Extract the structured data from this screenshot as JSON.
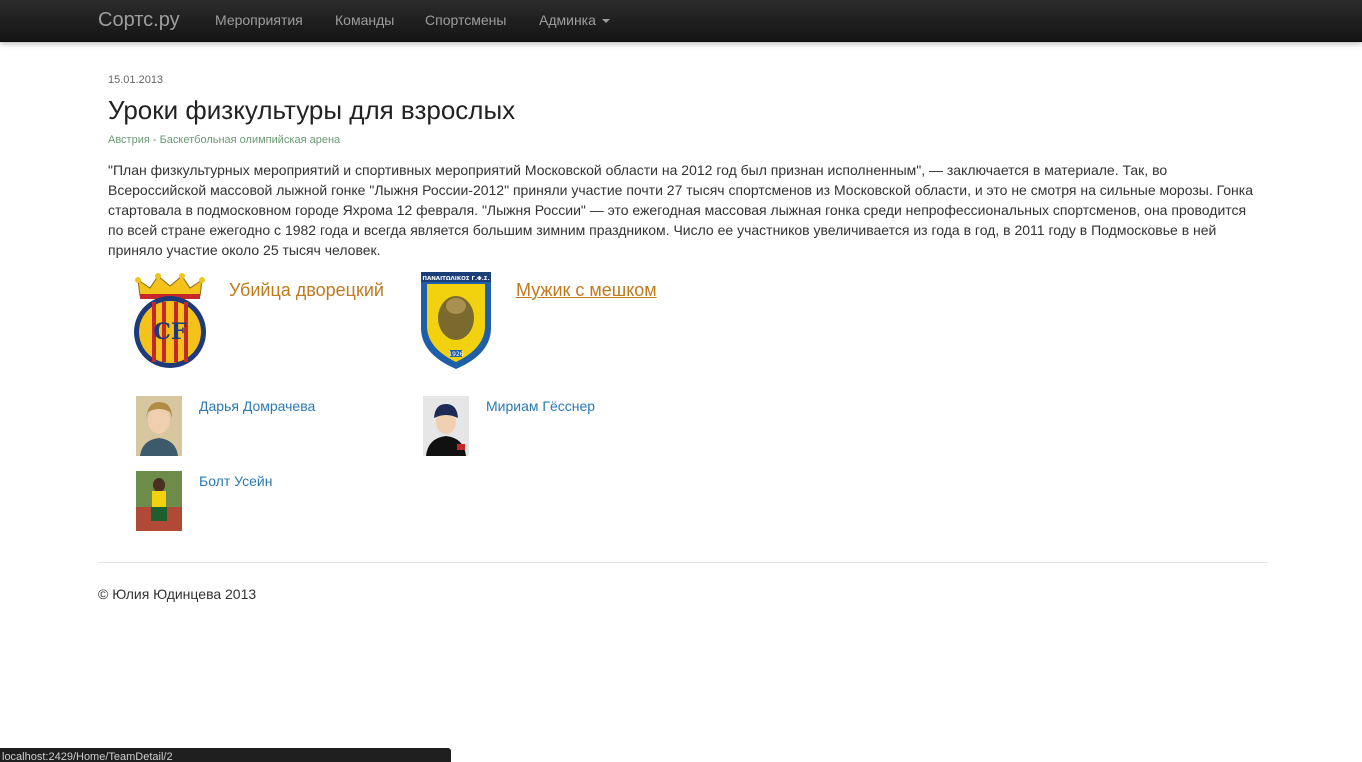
{
  "navbar": {
    "brand": "Сортс.ру",
    "links": [
      "Мероприятия",
      "Команды",
      "Спортсмены"
    ],
    "dropdown_label": "Админка"
  },
  "event": {
    "date": "15.01.2013",
    "title": "Уроки физкультуры для взрослых",
    "location": "Австрия - Баскетбольная олимпийская арена",
    "description": "\"План физкультурных мероприятий и спортивных мероприятий Московской области на 2012 год был признан исполненным\", — заключается в материале. Так, во Всероссийской массовой лыжной гонке \"Лыжня России-2012\" приняли участие почти 27 тысяч спортсменов из Московской области, и это не смотря на сильные морозы. Гонка стартовала в подмосковном городе Яхрома 12 февраля. \"Лыжня России\" — это ежегодная массовая лыжная гонка среди непрофессиональных спортсменов, она проводится по всей стране ежегодно с 1982 года и всегда является большим зимним праздником. Число ее участников увеличивается из года в год, в 2011 году в Подмосковье в ней приняло участие около 25 тысяч человек."
  },
  "teams": [
    {
      "name": "Убийца дворецкий",
      "logo": "cf-crest-icon",
      "logo_letters": "CF",
      "hovered": false
    },
    {
      "name": "Мужик с мешком",
      "logo": "panaitolikos-crest-icon",
      "logo_text": "ΠΑΝΑΙΤΩΛΙΚΟΣ Γ.Φ.Σ.",
      "logo_year": "1926",
      "hovered": true
    }
  ],
  "athletes": [
    {
      "name": "Дарья Домрачева",
      "photo": "athlete-photo-icon"
    },
    {
      "name": "Мириам Гёсснер",
      "photo": "athlete-photo-icon"
    },
    {
      "name": "Болт Усейн",
      "photo": "athlete-photo-icon"
    }
  ],
  "footer": {
    "copyright": "© Юлия Юдинцева 2013"
  },
  "statusbar": {
    "url": "localhost:2429/Home/TeamDetail/2"
  },
  "colors": {
    "navbar_bg": "#1b1b1b",
    "nav_text": "#9d9d9d",
    "team_link": "#c07a1e",
    "athlete_link": "#2a7ab4",
    "location_text": "#6a9a73"
  }
}
